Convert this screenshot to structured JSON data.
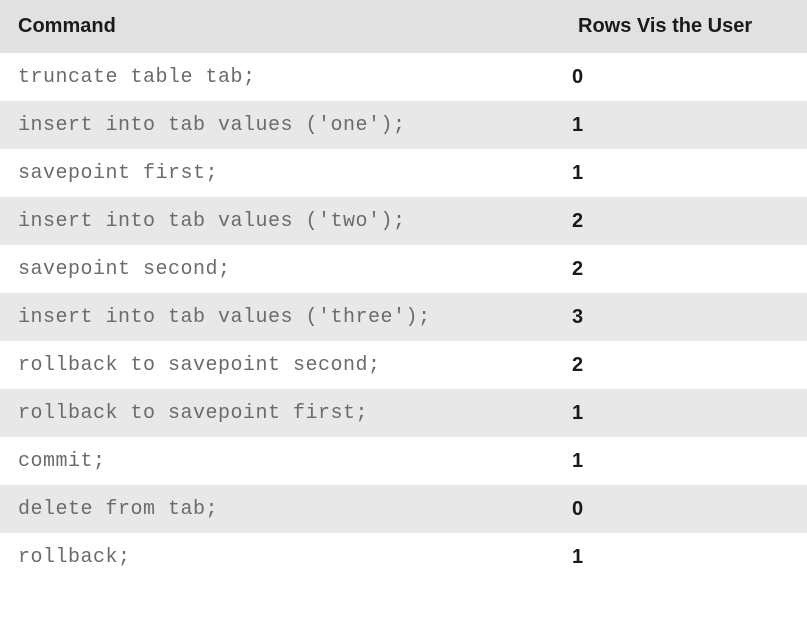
{
  "table": {
    "headers": {
      "command": "Command",
      "rows_visible": "Rows Vis\nthe User"
    },
    "rows": [
      {
        "command": "truncate table tab;",
        "rows_visible": "0"
      },
      {
        "command": "insert into tab values ('one');",
        "rows_visible": "1"
      },
      {
        "command": "savepoint first;",
        "rows_visible": "1"
      },
      {
        "command": "insert into tab values ('two');",
        "rows_visible": "2"
      },
      {
        "command": "savepoint second;",
        "rows_visible": "2"
      },
      {
        "command": "insert into tab values ('three');",
        "rows_visible": "3"
      },
      {
        "command": "rollback to savepoint second;",
        "rows_visible": "2"
      },
      {
        "command": "rollback to savepoint first;",
        "rows_visible": "1"
      },
      {
        "command": "commit;",
        "rows_visible": "1"
      },
      {
        "command": "delete from tab;",
        "rows_visible": "0"
      },
      {
        "command": "rollback;",
        "rows_visible": "1"
      }
    ]
  }
}
